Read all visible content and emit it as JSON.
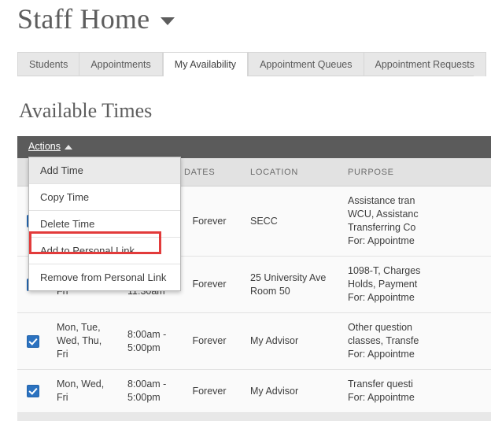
{
  "header": {
    "title": "Staff Home",
    "title_caret_icon": "chevron-down-icon"
  },
  "tabs": [
    {
      "label": "Students",
      "active": false
    },
    {
      "label": "Appointments",
      "active": false
    },
    {
      "label": "My Availability",
      "active": true
    },
    {
      "label": "Appointment Queues",
      "active": false
    },
    {
      "label": "Appointment Requests",
      "active": false
    }
  ],
  "section": {
    "heading": "Available Times"
  },
  "toolbar": {
    "actions_label": "Actions",
    "actions_caret_icon": "chevron-up-icon"
  },
  "dropdown": {
    "items": [
      {
        "label": "Add Time",
        "hovered": true,
        "highlighted": false
      },
      {
        "label": "Copy Time",
        "hovered": false,
        "highlighted": false
      },
      {
        "label": "Delete Time",
        "hovered": false,
        "highlighted": false
      },
      {
        "label": "Add to Personal Link",
        "hovered": false,
        "highlighted": true
      },
      {
        "label": "Remove from Personal Link",
        "hovered": false,
        "highlighted": false
      }
    ]
  },
  "annotation": {
    "target_label": "Add to Personal Link",
    "color": "#e23b3b"
  },
  "table": {
    "columns": [
      {
        "key": "select",
        "label": ""
      },
      {
        "key": "days",
        "label": ""
      },
      {
        "key": "times",
        "label": ""
      },
      {
        "key": "dates",
        "label": "DATES"
      },
      {
        "key": "location",
        "label": "LOCATION"
      },
      {
        "key": "purpose",
        "label": "PURPOSE"
      }
    ],
    "rows": [
      {
        "checked": true,
        "days": "",
        "times": "",
        "dates": "Forever",
        "location": "SECC",
        "purpose": [
          "Assistance tran",
          "WCU, Assistanc",
          "Transferring Co",
          "For: Appointme"
        ]
      },
      {
        "checked": true,
        "days": "Mon, Wed, Fri",
        "times": "8:00am - 11:30am",
        "dates": "Forever",
        "location": "25 University Ave Room 50",
        "purpose": [
          "1098-T, Charges",
          "Holds, Payment",
          "For: Appointme"
        ]
      },
      {
        "checked": true,
        "days": "Mon, Tue, Wed, Thu, Fri",
        "times": "8:00am - 5:00pm",
        "dates": "Forever",
        "location": "My Advisor",
        "purpose": [
          "Other question",
          "classes, Transfe",
          "For: Appointme"
        ]
      },
      {
        "checked": true,
        "days": "Mon, Wed, Fri",
        "times": "8:00am - 5:00pm",
        "dates": "Forever",
        "location": "My Advisor",
        "purpose": [
          "Transfer questi",
          "For: Appointme"
        ]
      }
    ]
  },
  "colors": {
    "toolbar_bg": "#5b5b5b",
    "header_bg": "#e2e2e2",
    "checkbox": "#2b72c0",
    "annotation_red": "#e23b3b"
  }
}
